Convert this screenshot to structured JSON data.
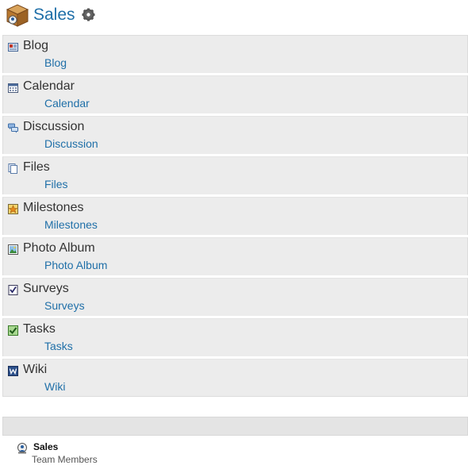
{
  "header": {
    "title": "Sales"
  },
  "sections": [
    {
      "title": "Blog",
      "link": "Blog",
      "icon": "blog-icon"
    },
    {
      "title": "Calendar",
      "link": "Calendar",
      "icon": "calendar-icon"
    },
    {
      "title": "Discussion",
      "link": "Discussion",
      "icon": "discussion-icon"
    },
    {
      "title": "Files",
      "link": "Files",
      "icon": "files-icon"
    },
    {
      "title": "Milestones",
      "link": "Milestones",
      "icon": "milestones-icon"
    },
    {
      "title": "Photo Album",
      "link": "Photo Album",
      "icon": "photo-album-icon"
    },
    {
      "title": "Surveys",
      "link": "Surveys",
      "icon": "surveys-icon"
    },
    {
      "title": "Tasks",
      "link": "Tasks",
      "icon": "tasks-icon"
    },
    {
      "title": "Wiki",
      "link": "Wiki",
      "icon": "wiki-icon"
    }
  ],
  "team": {
    "name": "Sales",
    "subtitle": "Team Members"
  },
  "colors": {
    "link": "#1f6fa8",
    "section_bg": "#ececec"
  }
}
